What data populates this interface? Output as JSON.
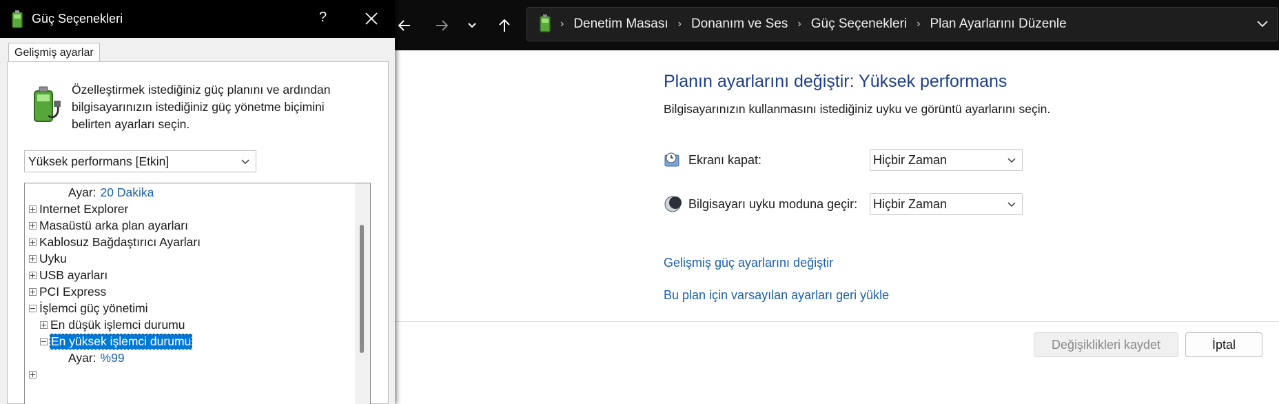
{
  "explorer": {
    "breadcrumb": [
      "Denetim Masası",
      "Donanım ve Ses",
      "Güç Seçenekleri",
      "Plan Ayarlarını Düzenle"
    ],
    "page_title": "Planın ayarlarını değiştir: Yüksek performans",
    "subtitle": "Bilgisayarınızın kullanmasını istediğiniz uyku ve görüntü ayarlarını seçin.",
    "display_off_label": "Ekranı kapat:",
    "display_off_value": "Hiçbir Zaman",
    "sleep_label": "Bilgisayarı uyku moduna geçir:",
    "sleep_value": "Hiçbir Zaman",
    "advanced_link": "Gelişmiş güç ayarlarını değiştir",
    "restore_link": "Bu plan için varsayılan ayarları geri yükle",
    "save_button": "Değişiklikleri kaydet",
    "cancel_button": "İptal"
  },
  "dialog": {
    "title": "Güç Seçenekleri",
    "help": "?",
    "tab": "Gelişmiş ayarlar",
    "description": "Özelleştirmek istediğiniz güç planını ve ardından bilgisayarınızın istediğiniz güç yönetme biçimini belirten ayarları seçin.",
    "plan_selected": "Yüksek performans [Etkin]",
    "tree": {
      "row0_label": "Ayar:",
      "row0_value": "20 Dakika",
      "row1": "Internet Explorer",
      "row2": "Masaüstü arka plan ayarları",
      "row3": "Kablosuz Bağdaştırıcı Ayarları",
      "row4": "Uyku",
      "row5": "USB ayarları",
      "row6": "PCI Express",
      "row7": "İşlemci güç yönetimi",
      "row8": "En düşük işlemci durumu",
      "row9": "En yüksek işlemci durumu",
      "row10_label": "Ayar:",
      "row10_value": "%99"
    }
  },
  "colors": {
    "title_blue": "#1e3e8c",
    "link_blue": "#1a5fb4",
    "selection": "#0078d7"
  }
}
